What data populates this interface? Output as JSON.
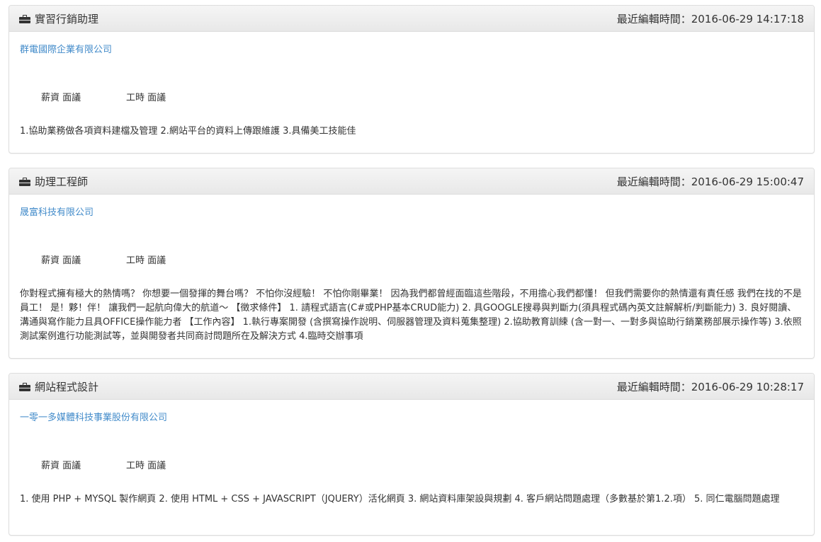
{
  "jobs": [
    {
      "title": "實習行銷助理",
      "edit_time": "最近編輯時間：2016-06-29 14:17:18",
      "company": "群電國際企業有限公司",
      "salary": "薪資 面議",
      "hours": "工時 面議",
      "description": "1.協助業務做各項資料建檔及管理 2.網站平台的資料上傳跟維護 3.具備美工技能佳"
    },
    {
      "title": "助理工程師",
      "edit_time": "最近編輯時間：2016-06-29 15:00:47",
      "company": "晟富科技有限公司",
      "salary": "薪資 面議",
      "hours": "工時 面議",
      "description": "你對程式擁有極大的熱情嗎？ 你想要一個發揮的舞台嗎？ 不怕你沒經驗！ 不怕你剛畢業！ 因為我們都曾經面臨這些階段，不用擔心我們都懂！ 但我們需要你的熱情還有責任感 我們在找的不是員工！ 是！夥！伴！ 讓我們一起航向偉大的航道～ 【徵求條件】 1. 請程式語言(C#或PHP基本CRUD能力) 2. 具GOOGLE搜尋與判斷力(須具程式碼內英文註解解析/判斷能力) 3. 良好閱讀、溝通與寫作能力且具OFFICE操作能力者 【工作內容】 1.執行專案開發 (含撰寫操作說明、伺服器管理及資料蒐集整理) 2.協助教育訓練 (含一對一、一對多與協助行銷業務部展示操作等) 3.依照測試案例進行功能測試等，並與開發者共同商討問題所在及解決方式 4.臨時交辦事項"
    },
    {
      "title": "網站程式設計",
      "edit_time": "最近編輯時間：2016-06-29 10:28:17",
      "company": "一零一多媒體科技事業股份有限公司",
      "salary": "薪資 面議",
      "hours": "工時 面議",
      "description": "1. 使用 PHP + MYSQL 製作網頁 2. 使用 HTML + CSS + JAVASCRIPT（JQUERY）活化網頁 3. 網站資料庫架設與規劃 4. 客戶網站問題處理（多數基於第1.2.項） 5. 同仁電腦問題處理"
    }
  ]
}
